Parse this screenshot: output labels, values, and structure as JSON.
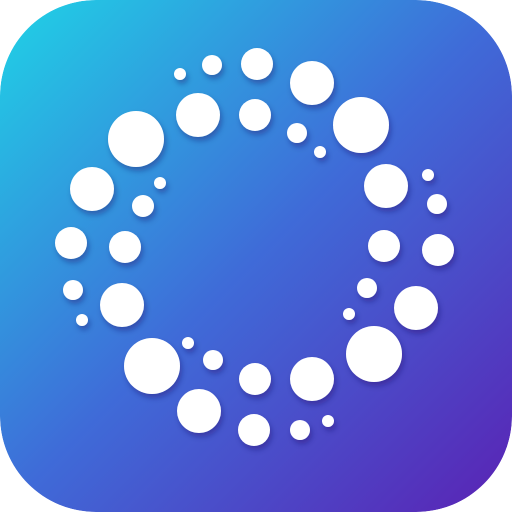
{
  "app_icon": {
    "name": "dot-ring-app-icon",
    "icon": "dotted-ring-icon",
    "colors": {
      "gradient_start": "#1fd3e6",
      "gradient_mid": "#3f6bd8",
      "gradient_end": "#5a22b4",
      "dot": "#ffffff"
    }
  }
}
